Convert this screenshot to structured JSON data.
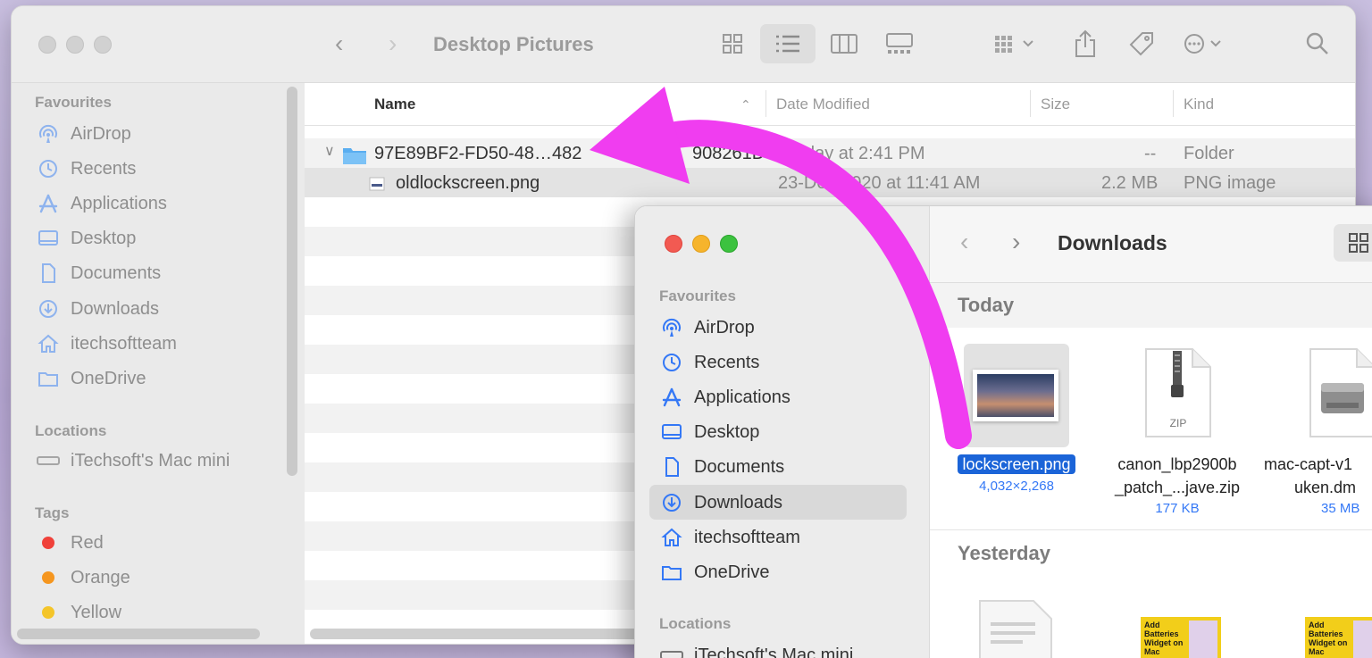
{
  "back_window": {
    "title": "Desktop Pictures",
    "sidebar": {
      "favourites_heading": "Favourites",
      "favourites": [
        {
          "label": "AirDrop",
          "icon": "airdrop-icon"
        },
        {
          "label": "Recents",
          "icon": "clock-icon"
        },
        {
          "label": "Applications",
          "icon": "applications-icon"
        },
        {
          "label": "Desktop",
          "icon": "desktop-icon"
        },
        {
          "label": "Documents",
          "icon": "document-icon"
        },
        {
          "label": "Downloads",
          "icon": "download-icon"
        },
        {
          "label": "itechsoftteam",
          "icon": "home-icon"
        },
        {
          "label": "OneDrive",
          "icon": "folder-icon"
        }
      ],
      "locations_heading": "Locations",
      "locations": [
        {
          "label": "iTechsoft's Mac mini",
          "icon": "computer-icon"
        }
      ],
      "tags_heading": "Tags",
      "tags": [
        {
          "label": "Red",
          "color": "#f0413a"
        },
        {
          "label": "Orange",
          "color": "#f5961f"
        },
        {
          "label": "Yellow",
          "color": "#f4c52a"
        }
      ]
    },
    "columns": {
      "name": "Name",
      "date": "Date Modified",
      "size": "Size",
      "kind": "Kind"
    },
    "rows": [
      {
        "name": "97E89BF2-FD50-48…482",
        "name_tail": "908261D",
        "date": "day at 2:41 PM",
        "size": "--",
        "kind": "Folder"
      },
      {
        "name": "oldlockscreen.png",
        "date": "23-Dec-2020 at 11:41 AM",
        "size": "2.2 MB",
        "kind": "PNG image"
      }
    ]
  },
  "front_window": {
    "title": "Downloads",
    "sidebar": {
      "favourites_heading": "Favourites",
      "favourites": [
        {
          "label": "AirDrop",
          "icon": "airdrop-icon"
        },
        {
          "label": "Recents",
          "icon": "clock-icon"
        },
        {
          "label": "Applications",
          "icon": "applications-icon"
        },
        {
          "label": "Desktop",
          "icon": "desktop-icon"
        },
        {
          "label": "Documents",
          "icon": "document-icon"
        },
        {
          "label": "Downloads",
          "icon": "download-icon"
        },
        {
          "label": "itechsoftteam",
          "icon": "home-icon"
        },
        {
          "label": "OneDrive",
          "icon": "folder-icon"
        }
      ],
      "selected": "Downloads",
      "locations_heading": "Locations",
      "locations": [
        {
          "label": "iTechsoft's Mac mini",
          "icon": "computer-icon"
        }
      ]
    },
    "sections": {
      "today": "Today",
      "yesterday": "Yesterday"
    },
    "today_files": [
      {
        "name": "lockscreen.png",
        "meta": "4,032×2,268"
      },
      {
        "name_line1": "canon_lbp2900b",
        "name_line2": "_patch_...jave.zip",
        "meta": "177 KB",
        "badge": "ZIP"
      },
      {
        "name_line1": "mac-capt-v1",
        "name_line2": "uken.dm",
        "meta": "35 MB"
      }
    ],
    "yesterday_thumb_text": "Add Batteries Widget on Mac"
  },
  "colors": {
    "accent": "#3478f6",
    "arrow": "#f03df0",
    "selection": "#1b64d8"
  }
}
